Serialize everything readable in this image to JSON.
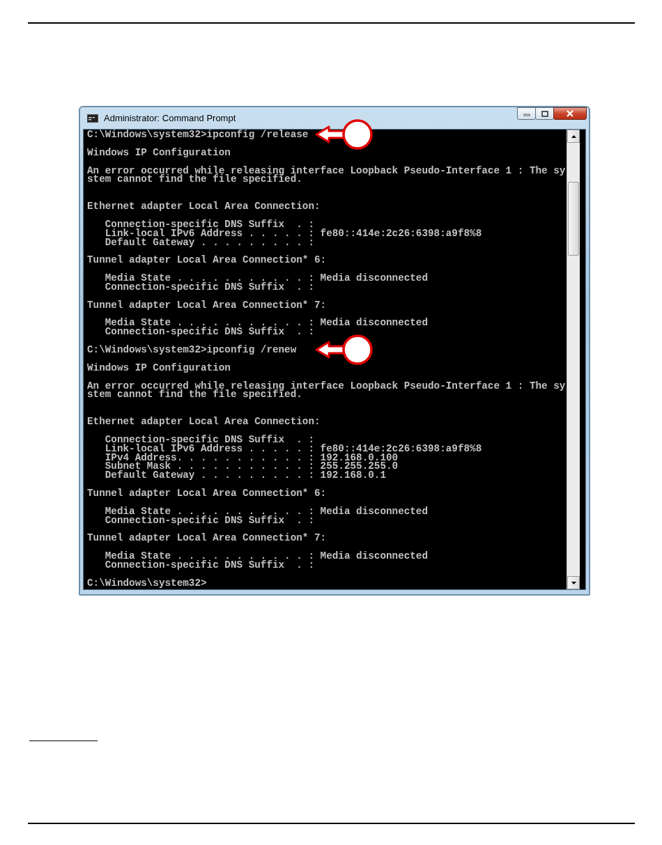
{
  "window": {
    "title": "Administrator: Command Prompt"
  },
  "console": {
    "lines": [
      {
        "kind": "command",
        "text": "C:\\Windows\\system32>ipconfig /release",
        "callout": true
      },
      {
        "kind": "blank"
      },
      {
        "kind": "output",
        "text": "Windows IP Configuration",
        "callout": false
      },
      {
        "kind": "blank"
      },
      {
        "kind": "output",
        "text": "An error occurred while releasing interface Loopback Pseudo-Interface 1 : The sy",
        "callout": false
      },
      {
        "kind": "output",
        "text": "stem cannot find the file specified.",
        "callout": false
      },
      {
        "kind": "blank"
      },
      {
        "kind": "blank"
      },
      {
        "kind": "output",
        "text": "Ethernet adapter Local Area Connection:",
        "callout": false
      },
      {
        "kind": "blank"
      },
      {
        "kind": "output",
        "text": "   Connection-specific DNS Suffix  . :",
        "callout": false
      },
      {
        "kind": "output",
        "text": "   Link-local IPv6 Address . . . . . : fe80::414e:2c26:6398:a9f8%8",
        "callout": false
      },
      {
        "kind": "output",
        "text": "   Default Gateway . . . . . . . . . :",
        "callout": false
      },
      {
        "kind": "blank"
      },
      {
        "kind": "output",
        "text": "Tunnel adapter Local Area Connection* 6:",
        "callout": false
      },
      {
        "kind": "blank"
      },
      {
        "kind": "output",
        "text": "   Media State . . . . . . . . . . . : Media disconnected",
        "callout": false
      },
      {
        "kind": "output",
        "text": "   Connection-specific DNS Suffix  . :",
        "callout": false
      },
      {
        "kind": "blank"
      },
      {
        "kind": "output",
        "text": "Tunnel adapter Local Area Connection* 7:",
        "callout": false
      },
      {
        "kind": "blank"
      },
      {
        "kind": "output",
        "text": "   Media State . . . . . . . . . . . : Media disconnected",
        "callout": false
      },
      {
        "kind": "output",
        "text": "   Connection-specific DNS Suffix  . :",
        "callout": false
      },
      {
        "kind": "blank"
      },
      {
        "kind": "command",
        "text": "C:\\Windows\\system32>ipconfig /renew",
        "callout": true
      },
      {
        "kind": "blank"
      },
      {
        "kind": "output",
        "text": "Windows IP Configuration",
        "callout": false
      },
      {
        "kind": "blank"
      },
      {
        "kind": "output",
        "text": "An error occurred while releasing interface Loopback Pseudo-Interface 1 : The sy",
        "callout": false
      },
      {
        "kind": "output",
        "text": "stem cannot find the file specified.",
        "callout": false
      },
      {
        "kind": "blank"
      },
      {
        "kind": "blank"
      },
      {
        "kind": "output",
        "text": "Ethernet adapter Local Area Connection:",
        "callout": false
      },
      {
        "kind": "blank"
      },
      {
        "kind": "output",
        "text": "   Connection-specific DNS Suffix  . :",
        "callout": false
      },
      {
        "kind": "output",
        "text": "   Link-local IPv6 Address . . . . . : fe80::414e:2c26:6398:a9f8%8",
        "callout": false
      },
      {
        "kind": "output",
        "text": "   IPv4 Address. . . . . . . . . . . : 192.168.0.100",
        "callout": false
      },
      {
        "kind": "output",
        "text": "   Subnet Mask . . . . . . . . . . . : 255.255.255.0",
        "callout": false
      },
      {
        "kind": "output",
        "text": "   Default Gateway . . . . . . . . . : 192.168.0.1",
        "callout": false
      },
      {
        "kind": "blank"
      },
      {
        "kind": "output",
        "text": "Tunnel adapter Local Area Connection* 6:",
        "callout": false
      },
      {
        "kind": "blank"
      },
      {
        "kind": "output",
        "text": "   Media State . . . . . . . . . . . : Media disconnected",
        "callout": false
      },
      {
        "kind": "output",
        "text": "   Connection-specific DNS Suffix  . :",
        "callout": false
      },
      {
        "kind": "blank"
      },
      {
        "kind": "output",
        "text": "Tunnel adapter Local Area Connection* 7:",
        "callout": false
      },
      {
        "kind": "blank"
      },
      {
        "kind": "output",
        "text": "   Media State . . . . . . . . . . . : Media disconnected",
        "callout": false
      },
      {
        "kind": "output",
        "text": "   Connection-specific DNS Suffix  . :",
        "callout": false
      },
      {
        "kind": "blank"
      },
      {
        "kind": "command",
        "text": "C:\\Windows\\system32>",
        "callout": false
      }
    ]
  }
}
